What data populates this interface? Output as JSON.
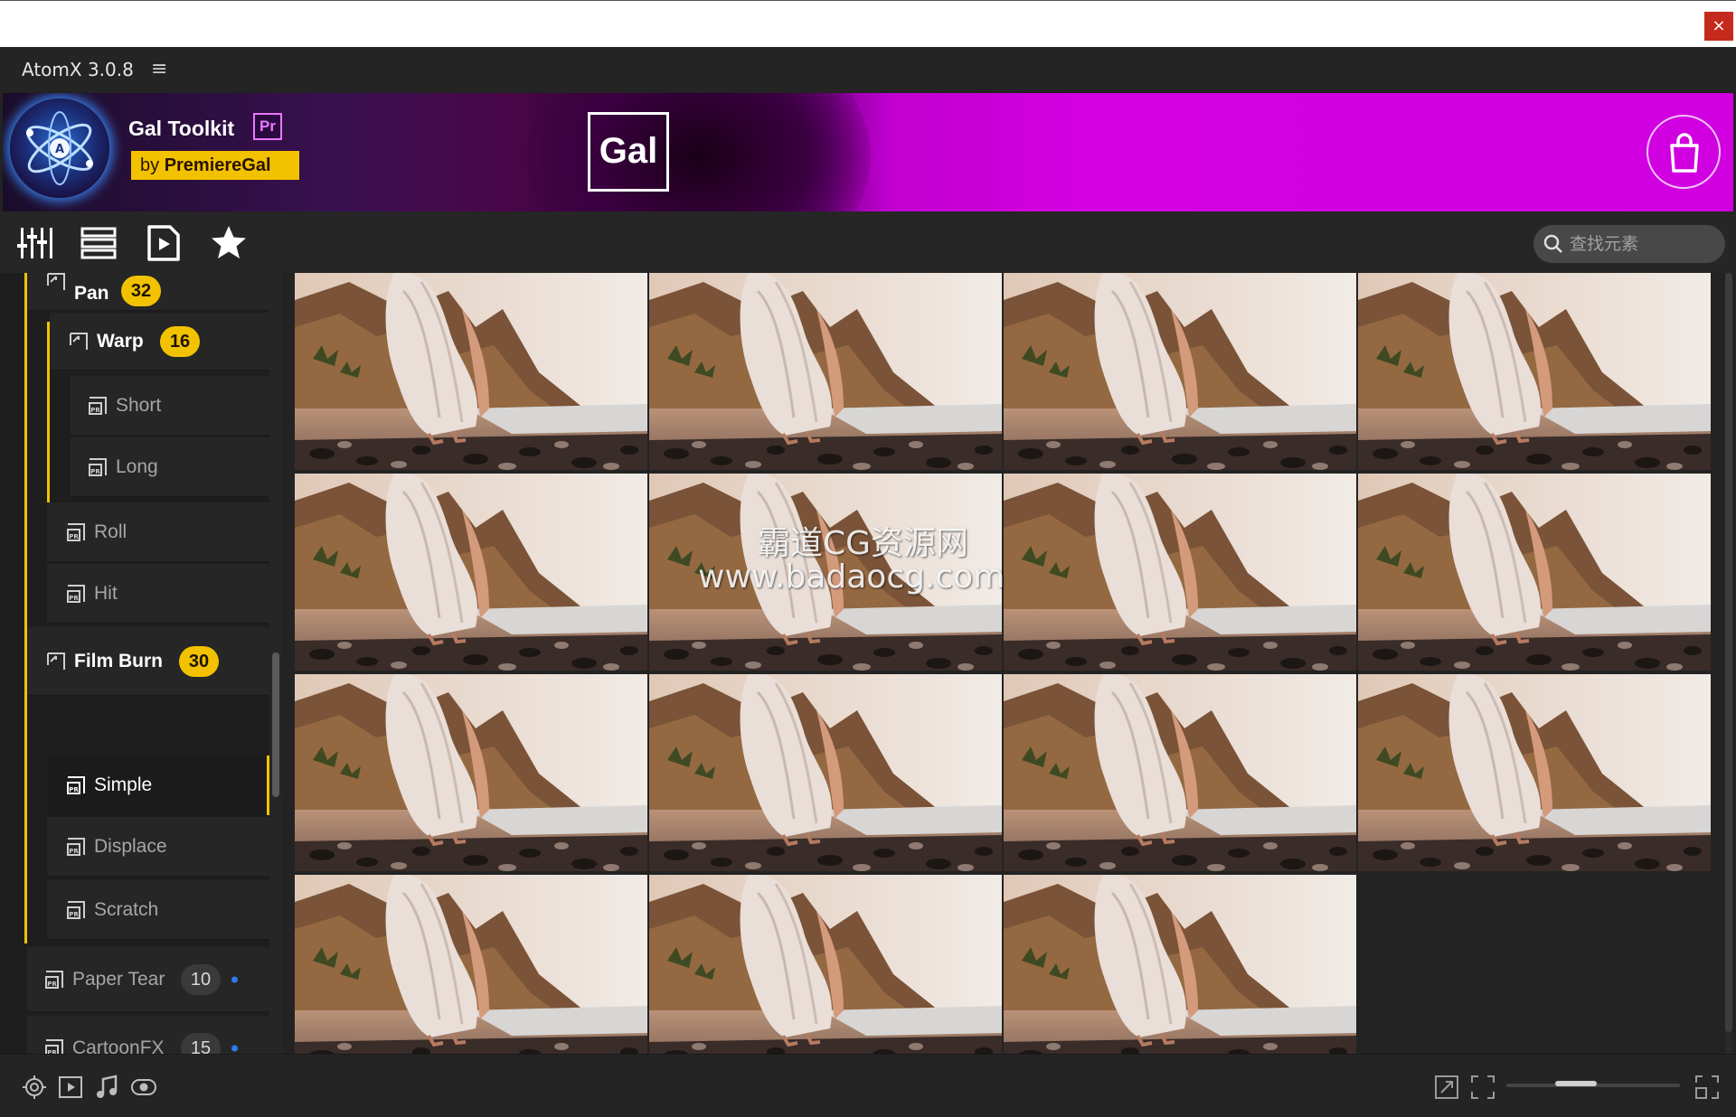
{
  "window": {
    "close_glyph": "×"
  },
  "app": {
    "name": "AtomX 3.0.8",
    "menu_glyph": "≡"
  },
  "banner": {
    "title": "Gal Toolkit",
    "pr_badge": "Pr",
    "by_prefix": "by ",
    "by_name": "PremiereGal",
    "center_logo": "Gal"
  },
  "toolbar": {
    "tools": [
      "sliders-icon",
      "list-icon",
      "video-file-icon",
      "star-icon"
    ],
    "search_placeholder": "查找元素"
  },
  "sidebar": {
    "items": [
      {
        "label": "Pan",
        "count": "32"
      },
      {
        "label": "Warp",
        "count": "16"
      },
      {
        "label": "Short"
      },
      {
        "label": "Long"
      },
      {
        "label": "Roll"
      },
      {
        "label": "Hit"
      },
      {
        "label": "Film Burn",
        "count": "30"
      },
      {
        "label": "Simple",
        "selected": true
      },
      {
        "label": "Displace"
      },
      {
        "label": "Scratch"
      },
      {
        "label": "Paper Tear",
        "count": "10"
      },
      {
        "label": "CartoonFX",
        "count": "15"
      }
    ]
  },
  "grid": {
    "thumbnail_count": 15,
    "columns": 4
  },
  "watermark": {
    "line1": "霸道CG资源网",
    "line2": "www.badaocg.com"
  },
  "bottombar": {
    "zoom_level": 0.37
  },
  "colors": {
    "accent": "#f2c200",
    "banner_magenta": "#d400e0",
    "selection": "#f2c200"
  }
}
